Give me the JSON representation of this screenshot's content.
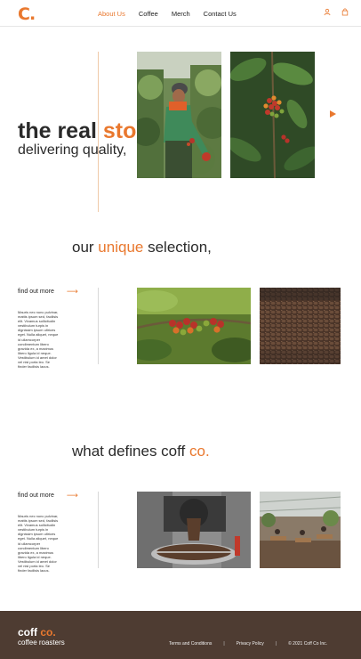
{
  "header": {
    "logo": "C.",
    "nav": [
      {
        "label": "About Us",
        "active": true
      },
      {
        "label": "Coffee",
        "active": false
      },
      {
        "label": "Merch",
        "active": false
      },
      {
        "label": "Contact Us",
        "active": false
      }
    ],
    "icons": [
      "user-icon",
      "bag-icon"
    ]
  },
  "hero": {
    "title_main": "the real ",
    "title_accent": "story,",
    "subtitle": "delivering quality,"
  },
  "selection": {
    "heading_pre": "our ",
    "heading_accent": "unique",
    "heading_post": " selection,",
    "find_more": "find out more",
    "text": "Mauris nec nunc pulvinar, mattis ipsum sed, facilisis elit. Vivamus sollicitudin vestibulum turpis in dignissim ipsum ultrices eget. Nulla aliquet, neque id ullamcorper condimentum libero gravida ex, a maximus libero ligula id neque. Vestibulum id amet dolor vel nisl porta leo. Se finder facilisis lacus."
  },
  "defines": {
    "heading_pre": "what defines coff ",
    "heading_accent": "co.",
    "find_more": "find out more",
    "text": "Mauris nec nunc pulvinar, mattis ipsum sed, facilisis elit. Vivamus sollicitudin vestibulum turpis in dignissim ipsum ultrices eget. Nulla aliquet, neque id ullamcorper condimentum libero gravida ex, a maximus libero ligula id neque. Vestibulum id amet dolor vel nisl porta leo. Se finder facilisis lacus."
  },
  "footer": {
    "brand_main": "coff ",
    "brand_accent": "co.",
    "tagline": "coffee roasters",
    "links": [
      "Terms and Conditions",
      "Privacy Policy",
      "© 2021 Coff Co Inc."
    ],
    "separator": "|"
  },
  "colors": {
    "accent": "#e9782e",
    "footer_bg": "#4e3c32"
  }
}
